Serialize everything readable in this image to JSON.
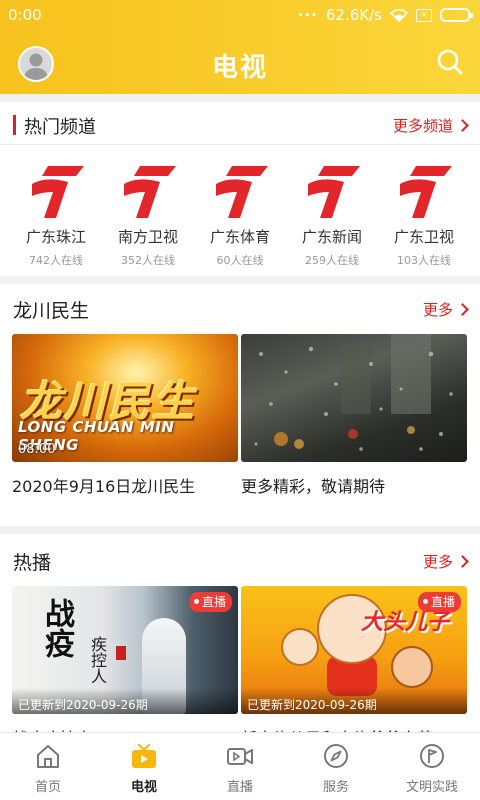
{
  "status_bar": {
    "time": "0:00",
    "network_speed": "62.6K/s",
    "sim_label": "×"
  },
  "header": {
    "title": "电视"
  },
  "hot_channels": {
    "title": "热门频道",
    "more_label": "更多频道",
    "items": [
      {
        "name": "广东珠江",
        "viewers": "742人在线"
      },
      {
        "name": "南方卫视",
        "viewers": "352人在线"
      },
      {
        "name": "广东体育",
        "viewers": "60人在线"
      },
      {
        "name": "广东新闻",
        "viewers": "259人在线"
      },
      {
        "name": "广东卫视",
        "viewers": "103人在线"
      }
    ]
  },
  "longchuan": {
    "title": "龙川民生",
    "more_label": "更多",
    "cards": [
      {
        "thumb_title": "龙川民生",
        "thumb_subtitle": "LONG CHUAN MIN SHENG",
        "duration": "08:00",
        "caption": "2020年9月16日龙川民生"
      },
      {
        "caption": "更多精彩，敬请期待"
      }
    ]
  },
  "hot_broadcast": {
    "title": "热播",
    "more_label": "更多",
    "cards": [
      {
        "badge": "直播",
        "updated": "已更新到2020-09-26期",
        "caption": "战疫疾控人",
        "thumb_title": "战疫",
        "thumb_sub": "疾控人"
      },
      {
        "badge": "直播",
        "updated": "已更新到2020-09-26期",
        "caption": "新大头儿子和小头爸爸之英",
        "thumb_title": "大头儿子"
      }
    ]
  },
  "bottom_nav": {
    "items": [
      {
        "label": "首页",
        "icon": "home-icon"
      },
      {
        "label": "电视",
        "icon": "tv-icon"
      },
      {
        "label": "直播",
        "icon": "video-camera-icon"
      },
      {
        "label": "服务",
        "icon": "compass-icon"
      },
      {
        "label": "文明实践",
        "icon": "flag-icon"
      }
    ],
    "active_index": 1
  },
  "colors": {
    "header": "#f9c82a",
    "accent_red": "#e02020",
    "nav_active": "#f6b80f"
  }
}
